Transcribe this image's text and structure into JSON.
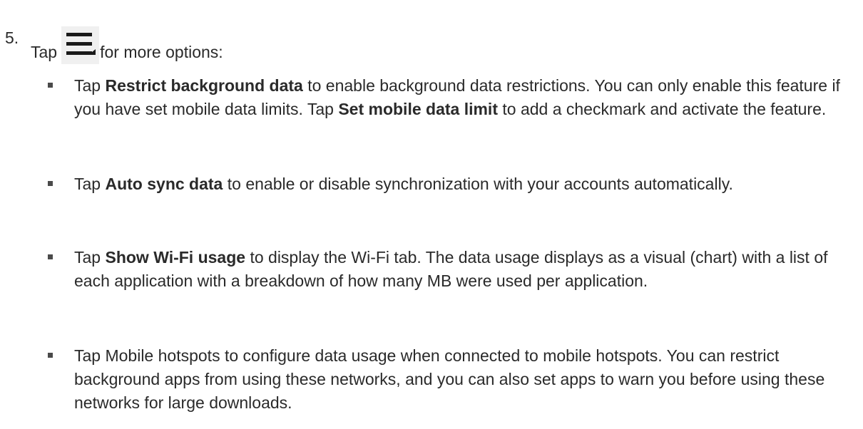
{
  "step": {
    "number": "5.",
    "before_icon": "Tap",
    "icon": "menu-icon",
    "after_icon": "for more options:"
  },
  "bullets": [
    {
      "pre": "Tap ",
      "bold": "Restrict background data",
      "mid": " to enable background data restrictions. You can only enable this feature if you have set mobile data limits. Tap ",
      "bold2": "Set mobile data limit",
      "post": " to add a checkmark and activate the feature."
    },
    {
      "pre": "Tap ",
      "bold": "Auto sync data",
      "post": " to enable or disable synchronization with your accounts automatically."
    },
    {
      "pre": "Tap ",
      "bold": "Show Wi-Fi usage",
      "post": " to display the Wi-Fi tab. The data usage displays as a visual (chart) with a list of each application with a breakdown of how many MB were used per application."
    },
    {
      "text": "Tap Mobile hotspots to configure data usage when connected to mobile hotspots. You can restrict background apps from using these networks, and you can also set apps to warn you before using these networks for large downloads."
    }
  ]
}
